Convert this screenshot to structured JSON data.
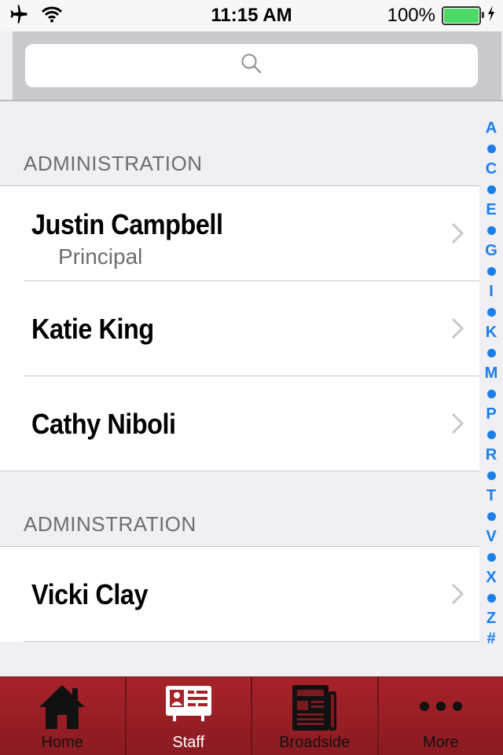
{
  "status_bar": {
    "time": "11:15 AM",
    "battery_text": "100%",
    "battery_color": "#4cd964"
  },
  "search": {
    "icon": "search-icon",
    "placeholder": ""
  },
  "sections": [
    {
      "header": "ADMINISTRATION",
      "rows": [
        {
          "name": "Justin Campbell",
          "title": "Principal"
        },
        {
          "name": "Katie King"
        },
        {
          "name": "Cathy Niboli"
        }
      ]
    },
    {
      "header": "ADMINSTRATION",
      "rows": [
        {
          "name": "Vicki Clay"
        }
      ]
    }
  ],
  "index": [
    "A",
    "C",
    "E",
    "G",
    "I",
    "K",
    "M",
    "P",
    "R",
    "T",
    "V",
    "X",
    "Z",
    "#"
  ],
  "index_color": "#1a7fe8",
  "tab_bar": {
    "color": "#a8222a",
    "tabs": [
      {
        "label": "Home",
        "icon": "home-icon"
      },
      {
        "label": "Staff",
        "icon": "staff-id-icon",
        "active": true
      },
      {
        "label": "Broadside",
        "icon": "newspaper-icon"
      },
      {
        "label": "More",
        "icon": "more-icon"
      }
    ]
  }
}
